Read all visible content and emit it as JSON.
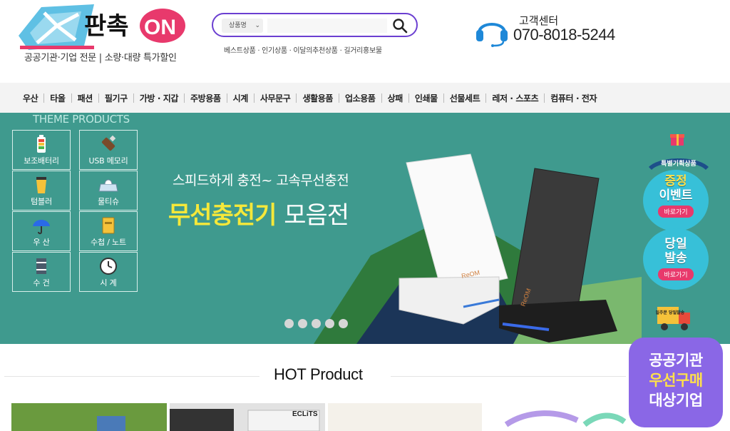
{
  "header": {
    "logo_text": "판촉ON",
    "tagline": "공공기관·기업 전문 | 소량·대량 특가할인",
    "search": {
      "category": "상품명",
      "placeholder": ""
    },
    "keywords": [
      "베스트상품",
      "인기상품",
      "이달의추천상품",
      "길거리홍보물"
    ],
    "customer_center": {
      "title": "고객센터",
      "phone": "070-8018-5244"
    }
  },
  "nav": {
    "items": [
      "우산",
      "타올",
      "패션",
      "필기구",
      "가방 · 지갑",
      "주방용품",
      "시계",
      "사무문구",
      "생활용품",
      "업소용품",
      "상패",
      "인쇄물",
      "선물세트",
      "레저 · 스포츠",
      "컴퓨터 · 전자"
    ]
  },
  "banner": {
    "theme_title": "THEME PRODUCTS",
    "themes": [
      {
        "label": "보조배터리",
        "icon": "battery-icon"
      },
      {
        "label": "USB 메모리",
        "icon": "usb-icon"
      },
      {
        "label": "텀블러",
        "icon": "tumbler-icon"
      },
      {
        "label": "물티슈",
        "icon": "wet-tissue-icon"
      },
      {
        "label": "우 산",
        "icon": "umbrella-icon"
      },
      {
        "label": "수첩 / 노트",
        "icon": "notebook-icon"
      },
      {
        "label": "수 건",
        "icon": "towel-icon"
      },
      {
        "label": "시 계",
        "icon": "clock-icon"
      }
    ],
    "subtitle": "스피드하게 충전~ 고속무선충전",
    "title_highlight": "무선충전기",
    "title_rest": "모음전",
    "product_brand": "ReOM",
    "slide_count": 5
  },
  "side": {
    "special_label": "특별기획상품",
    "event": {
      "line1": "증정",
      "line2": "이벤트",
      "button": "바로가기"
    },
    "sameday": {
      "line1": "당일",
      "line2": "발송",
      "button": "바로가기"
    },
    "truck_label": "당일주문 당일발송"
  },
  "hot": {
    "title": "HOT Product",
    "thumb_brand": "ECLiTS"
  },
  "promo": {
    "line1": "공공기관",
    "line2": "우선구매",
    "line3": "대상기업"
  },
  "colors": {
    "accent_purple": "#6b3fd1",
    "banner_teal": "#3f9a8e",
    "highlight_yellow": "#f5e83a",
    "bubble_blue": "#37c0d8",
    "pink": "#e8396c",
    "promo_purple": "#8a67e6"
  }
}
